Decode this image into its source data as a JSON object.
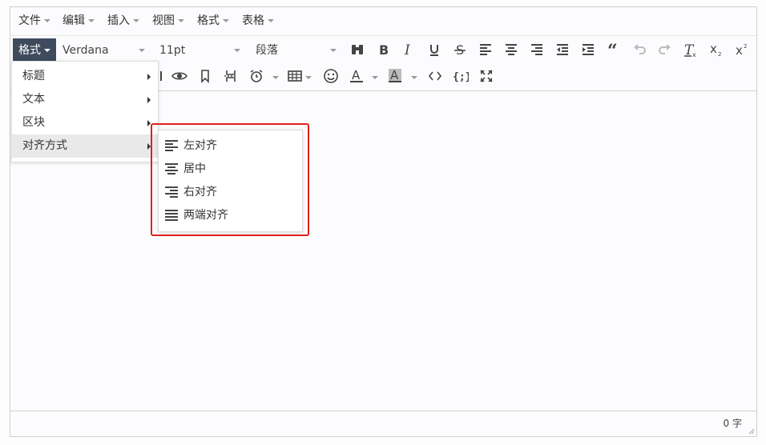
{
  "menubar": {
    "items": [
      {
        "label": "文件"
      },
      {
        "label": "编辑"
      },
      {
        "label": "插入"
      },
      {
        "label": "视图"
      },
      {
        "label": "格式"
      },
      {
        "label": "表格"
      }
    ]
  },
  "toolbar": {
    "format_label": "格式",
    "font_family": "Verdana",
    "font_size": "11pt",
    "block_format": "段落"
  },
  "format_menu": {
    "items": [
      {
        "label": "标题"
      },
      {
        "label": "文本"
      },
      {
        "label": "区块"
      },
      {
        "label": "对齐方式"
      }
    ]
  },
  "align_submenu": {
    "items": [
      {
        "label": "左对齐"
      },
      {
        "label": "居中"
      },
      {
        "label": "右对齐"
      },
      {
        "label": "两端对齐"
      }
    ]
  },
  "status": {
    "word_count": "0 字"
  },
  "colors": {
    "accent_dark": "#3d4b5c",
    "highlight_red": "#e0201b",
    "active_row": "#e9e9ea"
  }
}
